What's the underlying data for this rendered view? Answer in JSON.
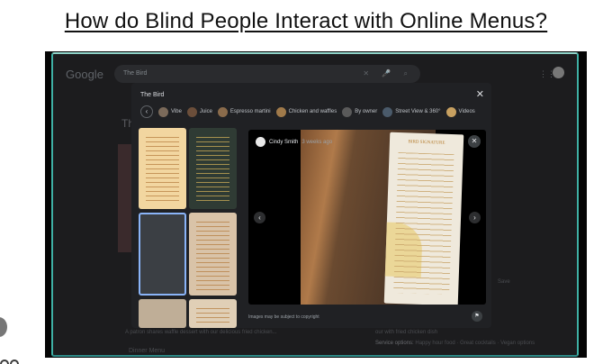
{
  "slide": {
    "title": "How do Blind People Interact with Online Menus?"
  },
  "google": {
    "logo": "Google",
    "search_value": "The Bird",
    "search_tool_icons": "✕ 🎤 ⌕",
    "apps_glyph": "⋮⋮",
    "bg_heading": "Th",
    "bg_caption": "A patron shares waffle dessert with our delicious fried chicken...",
    "bg_link": "Dinner Menu",
    "bg_right_1": "our with fried chicken dish",
    "bg_right_label": "Service options:",
    "bg_right_2": "Happy hour food · Great cocktails · Vegan options",
    "bg_save": "Save"
  },
  "modal": {
    "title": "The Bird",
    "close_glyph": "✕",
    "chip_prev": "‹",
    "chips": [
      {
        "label": "Vibe",
        "color": "#7b6a5a"
      },
      {
        "label": "Juice",
        "color": "#6b4e3a"
      },
      {
        "label": "Espresso martini",
        "color": "#8a6b4b"
      },
      {
        "label": "Chicken and waffles",
        "color": "#a07a4a"
      },
      {
        "label": "By owner",
        "color": "#5a5a5a"
      },
      {
        "label": "Street View & 360°",
        "color": "#4a5a6a"
      },
      {
        "label": "Videos",
        "color": "#c7a060"
      }
    ],
    "viewer": {
      "user": "Cindy Smith",
      "time": "3 weeks ago",
      "close_glyph": "✕",
      "prev_glyph": "‹",
      "next_glyph": "›",
      "menu_heading": "BIRD SIGNATURE"
    },
    "copyright": "Images may be subject to copyright",
    "flag_glyph": "⚑"
  }
}
